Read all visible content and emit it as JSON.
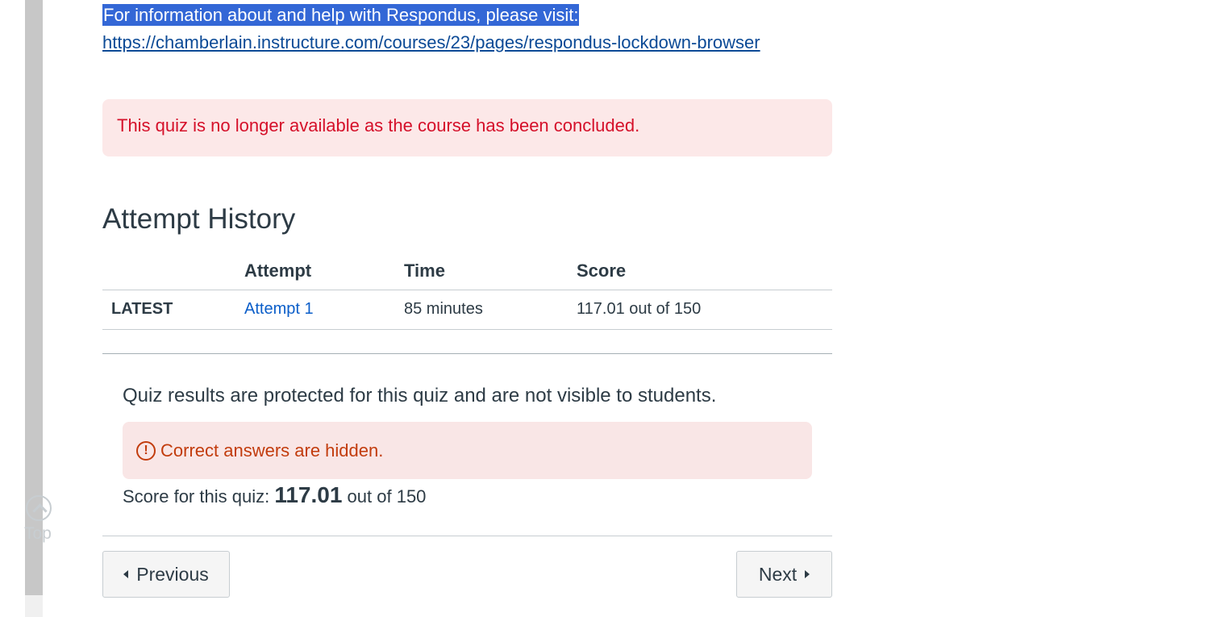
{
  "info": {
    "text": "For information about and help with Respondus, please visit:",
    "link": "https://chamberlain.instructure.com/courses/23/pages/respondus-lockdown-browser "
  },
  "alert_concluded": "This quiz is no longer available as the course has been concluded.",
  "attempt_history": {
    "title": "Attempt History",
    "headers": [
      "",
      "Attempt",
      "Time",
      "Score"
    ],
    "rows": [
      {
        "label": "LATEST",
        "attempt": "Attempt 1",
        "time": "85 minutes",
        "score": "117.01 out of 150"
      }
    ]
  },
  "results": {
    "protected_text": "Quiz results are protected for this quiz and are not visible to students.",
    "hidden_alert": "Correct answers are hidden.",
    "score_prefix": "Score for this quiz:",
    "score_value": "117.01",
    "score_suffix": "out of 150"
  },
  "nav": {
    "previous_label": "Previous",
    "next_label": "Next"
  },
  "back_to_top": {
    "label": "Top",
    "icon": "chevron-up-circle-icon"
  },
  "colors": {
    "link": "#0b4a96",
    "error": "#d5102a",
    "warning": "#c23c0d",
    "highlight": "#3367d6"
  }
}
